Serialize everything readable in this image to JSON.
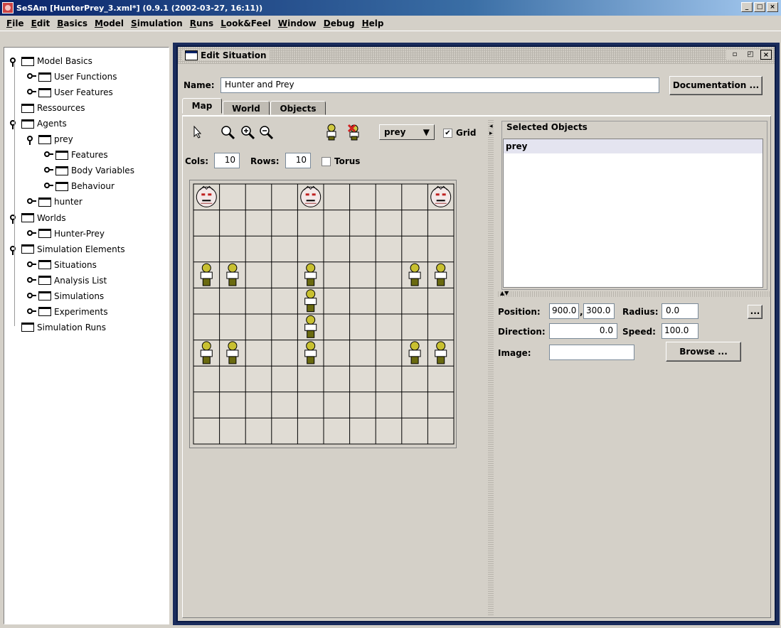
{
  "window": {
    "title": "SeSAm [HunterPrey_3.xml*] (0.9.1 (2002-03-27, 16:11))",
    "btn_min": "_",
    "btn_max": "□",
    "btn_close": "×"
  },
  "menu": [
    "File",
    "Edit",
    "Basics",
    "Model",
    "Simulation",
    "Runs",
    "Look&Feel",
    "Window",
    "Debug",
    "Help"
  ],
  "tree": [
    {
      "label": "Model Basics",
      "level": 0,
      "state": "open"
    },
    {
      "label": "User Functions",
      "level": 1,
      "state": "closed"
    },
    {
      "label": "User Features",
      "level": 1,
      "state": "closed"
    },
    {
      "label": "Ressources",
      "level": 0,
      "state": "leaf"
    },
    {
      "label": "Agents",
      "level": 0,
      "state": "open"
    },
    {
      "label": "prey",
      "level": 1,
      "state": "open"
    },
    {
      "label": "Features",
      "level": 2,
      "state": "closed"
    },
    {
      "label": "Body Variables",
      "level": 2,
      "state": "closed"
    },
    {
      "label": "Behaviour",
      "level": 2,
      "state": "closed"
    },
    {
      "label": "hunter",
      "level": 1,
      "state": "closed"
    },
    {
      "label": "Worlds",
      "level": 0,
      "state": "open"
    },
    {
      "label": "Hunter-Prey",
      "level": 1,
      "state": "closed"
    },
    {
      "label": "Simulation Elements",
      "level": 0,
      "state": "open"
    },
    {
      "label": "Situations",
      "level": 1,
      "state": "closed"
    },
    {
      "label": "Analysis List",
      "level": 1,
      "state": "closed"
    },
    {
      "label": "Simulations",
      "level": 1,
      "state": "closed"
    },
    {
      "label": "Experiments",
      "level": 1,
      "state": "closed"
    },
    {
      "label": "Simulation Runs",
      "level": 0,
      "state": "leaf"
    }
  ],
  "editor": {
    "title": "Edit Situation",
    "name_label": "Name:",
    "name_value": "Hunter and Prey",
    "documentation_button": "Documentation ...",
    "tabs": [
      "Map",
      "World",
      "Objects"
    ],
    "active_tab": "Map",
    "agent_select": "prey",
    "grid_label": "Grid",
    "grid_checked": true,
    "cols_label": "Cols:",
    "cols_value": "10",
    "rows_label": "Rows:",
    "rows_value": "10",
    "torus_label": "Torus",
    "torus_checked": false
  },
  "map": {
    "cols": 10,
    "rows": 10,
    "hunters": [
      [
        0,
        0
      ],
      [
        4,
        0
      ],
      [
        9,
        0
      ]
    ],
    "prey": [
      [
        0,
        3
      ],
      [
        1,
        3
      ],
      [
        4,
        3
      ],
      [
        8,
        3
      ],
      [
        9,
        3
      ],
      [
        4,
        4
      ],
      [
        4,
        5
      ],
      [
        0,
        6
      ],
      [
        1,
        6
      ],
      [
        4,
        6
      ],
      [
        8,
        6
      ],
      [
        9,
        6
      ]
    ]
  },
  "selected": {
    "title": "Selected Objects",
    "items": [
      "prey"
    ]
  },
  "props": {
    "position_label": "Position:",
    "pos_x": "900.0",
    "pos_y": "300.0",
    "radius_label": "Radius:",
    "radius_value": "0.0",
    "more_button": "...",
    "direction_label": "Direction:",
    "direction_value": "0.0",
    "speed_label": "Speed:",
    "speed_value": "100.0",
    "image_label": "Image:",
    "image_value": "",
    "browse_button": "Browse ..."
  }
}
